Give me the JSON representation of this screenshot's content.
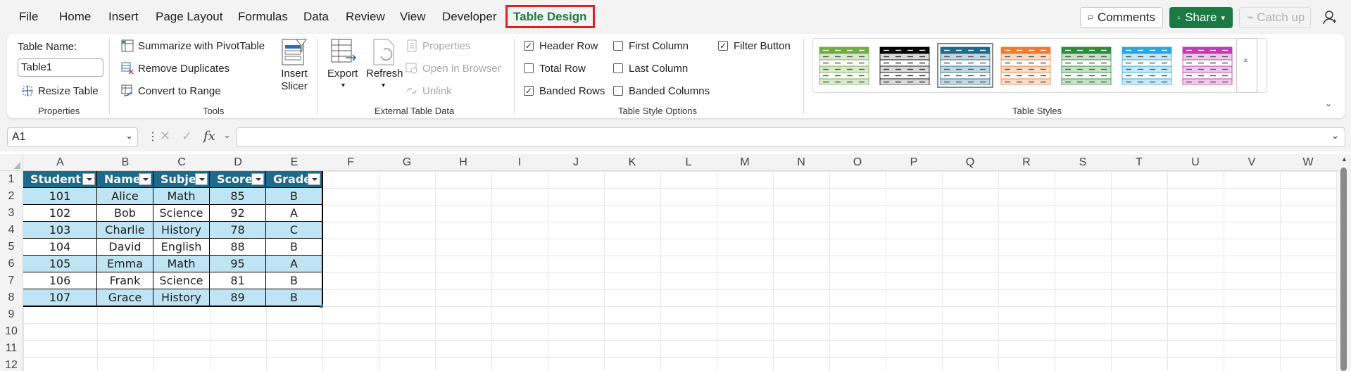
{
  "menu": {
    "tabs": [
      "File",
      "Home",
      "Insert",
      "Page Layout",
      "Formulas",
      "Data",
      "Review",
      "View",
      "Developer",
      "Table Design"
    ],
    "active_tab": "Table Design",
    "comments": "Comments",
    "share": "Share",
    "catch_up": "Catch up"
  },
  "ribbon": {
    "properties": {
      "table_name_label": "Table Name:",
      "table_name_value": "Table1",
      "resize": "Resize Table",
      "group": "Properties"
    },
    "tools": {
      "pivot": "Summarize with PivotTable",
      "remove_dup": "Remove Duplicates",
      "convert": "Convert to Range",
      "slicer": "Insert Slicer",
      "group": "Tools"
    },
    "external": {
      "export": "Export",
      "refresh": "Refresh",
      "properties": "Properties",
      "open_browser": "Open in Browser",
      "unlink": "Unlink",
      "group": "External Table Data"
    },
    "style_options": {
      "header_row": {
        "label": "Header Row",
        "checked": true
      },
      "total_row": {
        "label": "Total Row",
        "checked": false
      },
      "banded_rows": {
        "label": "Banded Rows",
        "checked": true
      },
      "first_column": {
        "label": "First Column",
        "checked": false
      },
      "last_column": {
        "label": "Last Column",
        "checked": false
      },
      "banded_columns": {
        "label": "Banded Columns",
        "checked": false
      },
      "filter_button": {
        "label": "Filter Button",
        "checked": true
      },
      "group": "Table Style Options"
    },
    "table_styles": {
      "group": "Table Styles",
      "swatch_colors": [
        "#70ad47",
        "#000000",
        "#1e6a8c",
        "#ed7d31",
        "#2e8b3a",
        "#29a8e0",
        "#c23ab5"
      ],
      "selected_index": 2
    }
  },
  "formula_bar": {
    "name_box": "A1",
    "fx": "fx",
    "formula": ""
  },
  "sheet": {
    "columns": [
      "A",
      "B",
      "C",
      "D",
      "E",
      "F",
      "G",
      "H",
      "I",
      "J",
      "K",
      "L",
      "M",
      "N",
      "O",
      "P",
      "Q",
      "R",
      "S",
      "T",
      "U",
      "V",
      "W"
    ],
    "rows": [
      "1",
      "2",
      "3",
      "4",
      "5",
      "6",
      "7",
      "8",
      "9",
      "10",
      "11",
      "12"
    ],
    "table": {
      "headers": [
        "Student I",
        "Name",
        "Subjec",
        "Score",
        "Grade"
      ],
      "data": [
        [
          "101",
          "Alice",
          "Math",
          "85",
          "B"
        ],
        [
          "102",
          "Bob",
          "Science",
          "92",
          "A"
        ],
        [
          "103",
          "Charlie",
          "History",
          "78",
          "C"
        ],
        [
          "104",
          "David",
          "English",
          "88",
          "B"
        ],
        [
          "105",
          "Emma",
          "Math",
          "95",
          "A"
        ],
        [
          "106",
          "Frank",
          "Science",
          "81",
          "B"
        ],
        [
          "107",
          "Grace",
          "History",
          "89",
          "B"
        ]
      ],
      "header_color": "#1e6a8c",
      "band_color": "#bfe4f3"
    }
  }
}
